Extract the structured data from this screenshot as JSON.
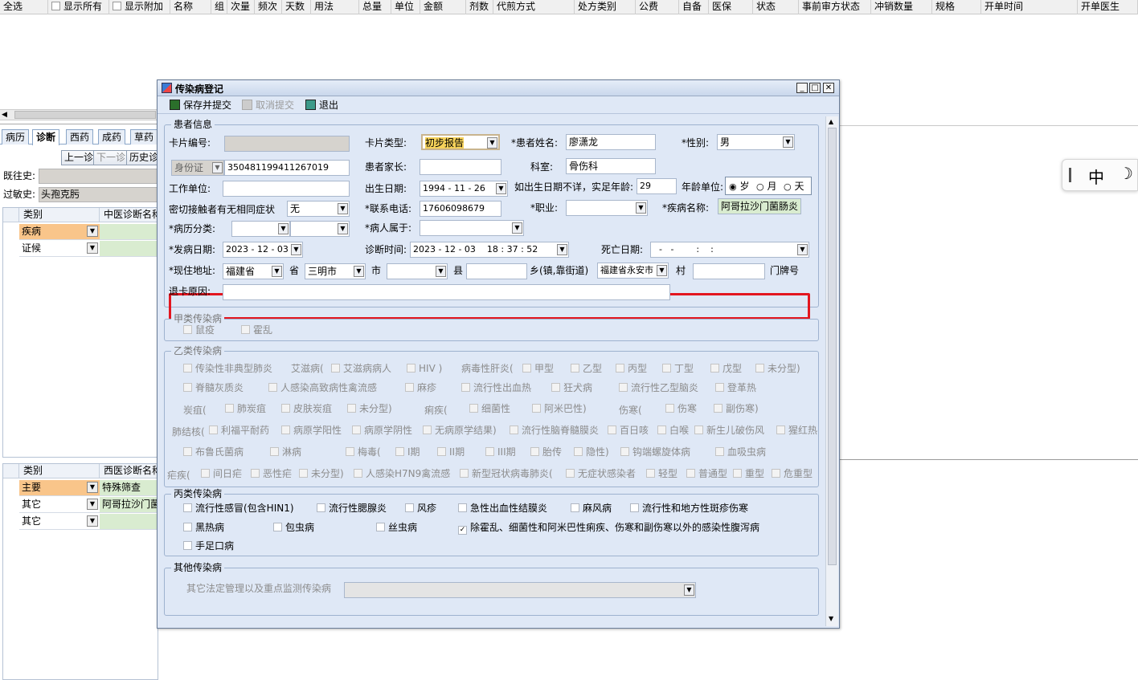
{
  "top_header": {
    "select_all": "全选",
    "show_all": "显示所有",
    "show_extra": "显示附加",
    "columns": [
      "名称",
      "组",
      "次量",
      "频次",
      "天数",
      "用法",
      "总量",
      "单位",
      "金额",
      "剂数",
      "代煎方式",
      "处方类别",
      "公费",
      "自备",
      "医保",
      "状态",
      "事前审方状态",
      "冲销数量",
      "规格",
      "开单时间",
      "开单医生"
    ]
  },
  "left_tabs": [
    "病历",
    "诊断",
    "西药",
    "成药",
    "草药"
  ],
  "nav_buttons": {
    "prev": "上一诊",
    "next": "下一诊",
    "history": "历史诊"
  },
  "history": {
    "past_label": "既往史:",
    "allergy_label": "过敏史:",
    "allergy_value": "头孢克肟"
  },
  "tcm_grid": {
    "header_type": "类别",
    "header_name": "中医诊断名称",
    "rows": [
      {
        "type": "疾病"
      },
      {
        "type": "证候"
      }
    ]
  },
  "wm_grid": {
    "header_type": "类别",
    "header_name": "西医诊断名称",
    "rows": [
      {
        "type": "主要",
        "name": "特殊筛查"
      },
      {
        "type": "其它",
        "name": "阿哥拉沙门菌"
      },
      {
        "type": "其它",
        "name": ""
      }
    ]
  },
  "ime": {
    "label": "中"
  },
  "dialog": {
    "title": "传染病登记",
    "toolbar": {
      "save": "保存并提交",
      "cancel": "取消提交",
      "exit": "退出"
    },
    "patient_group": "患者信息",
    "labels": {
      "card_no": "卡片编号:",
      "card_type": "卡片类型:",
      "patient_name": "*患者姓名:",
      "gender": "*性别:",
      "parent": "患者家长:",
      "dept": "科室:",
      "work": "工作单位:",
      "birth": "出生日期:",
      "age_note": "如出生日期不详，实足年龄:",
      "age_unit": "年龄单位:",
      "contact": "密切接触者有无相同症状",
      "phone": "*联系电话:",
      "job": "*职业:",
      "disease": "*疾病名称:",
      "case_class": "*病历分类:",
      "belongs": "*病人属于:",
      "onset": "*发病日期:",
      "diag_time": "诊断时间:",
      "death": "死亡日期:",
      "address": "*现住地址:",
      "province": "省",
      "city": "市",
      "county": "县",
      "town": "乡(镇,靠街道)",
      "village": "村",
      "house_no": "门牌号",
      "return_reason": "退卡原因:"
    },
    "values": {
      "card_type": "初步报告",
      "patient_name": "廖潇龙",
      "gender": "男",
      "id_type": "身份证",
      "id_no": "350481199411267019",
      "dept": "骨伤科",
      "birth": "1994 - 11 - 26",
      "age": "29",
      "unit_year": "岁",
      "unit_month": "月",
      "unit_day": "天",
      "contact": "无",
      "phone": "17606098679",
      "disease": "阿哥拉沙门菌肠炎",
      "onset": "2023 - 12 - 03",
      "diag_time": "2023 - 12 - 03    18 : 37 : 52",
      "death": "  -   -        :    :",
      "province": "福建省",
      "city": "三明市",
      "town": "福建省永安市"
    },
    "class_a": {
      "title": "甲类传染病",
      "items": [
        "鼠疫",
        "霍乱"
      ]
    },
    "class_b": {
      "title": "乙类传染病",
      "items": {
        "r1": [
          "传染性非典型肺炎",
          "艾滋病(",
          "艾滋病病人",
          "HIV )",
          "病毒性肝炎(",
          "甲型",
          "乙型",
          "丙型",
          "丁型",
          "戊型",
          "未分型)"
        ],
        "r2": [
          "脊髓灰质炎",
          "人感染高致病性禽流感",
          "麻疹",
          "流行性出血热",
          "狂犬病",
          "流行性乙型脑炎",
          "登革热"
        ],
        "r3": [
          "炭疽(",
          "肺炭疽",
          "皮肤炭疽",
          "未分型)",
          "痢疾(",
          "细菌性",
          "阿米巴性)",
          "伤寒(",
          "伤寒",
          "副伤寒)"
        ],
        "r4": [
          "肺结核(",
          "利福平耐药",
          "病原学阳性",
          "病原学阴性",
          "无病原学结果)",
          "流行性脑脊髓膜炎",
          "百日咳",
          "白喉",
          "新生儿破伤风",
          "猩红热"
        ],
        "r5": [
          "布鲁氏菌病",
          "淋病",
          "梅毒(",
          "I期",
          "II期",
          "III期",
          "胎传",
          "隐性)",
          "钩端螺旋体病",
          "血吸虫病"
        ],
        "r6": [
          "疟疾(",
          "间日疟",
          "恶性疟",
          "未分型)",
          "人感染H7N9禽流感",
          "新型冠状病毒肺炎(",
          "无症状感染者",
          "轻型",
          "普通型",
          "重型",
          "危重型"
        ]
      }
    },
    "class_c": {
      "title": "丙类传染病",
      "items": [
        "流行性感冒(包含HIN1)",
        "流行性腮腺炎",
        "风疹",
        "急性出血性结膜炎",
        "麻风病",
        "流行性和地方性斑疹伤寒",
        "黑热病",
        "包虫病",
        "丝虫病",
        "除霍乱、细菌性和阿米巴性痢疾、伤寒和副伤寒以外的感染性腹泻病",
        "手足口病"
      ]
    },
    "other": {
      "title": "其他传染病",
      "label": "其它法定管理以及重点监测传染病"
    }
  }
}
